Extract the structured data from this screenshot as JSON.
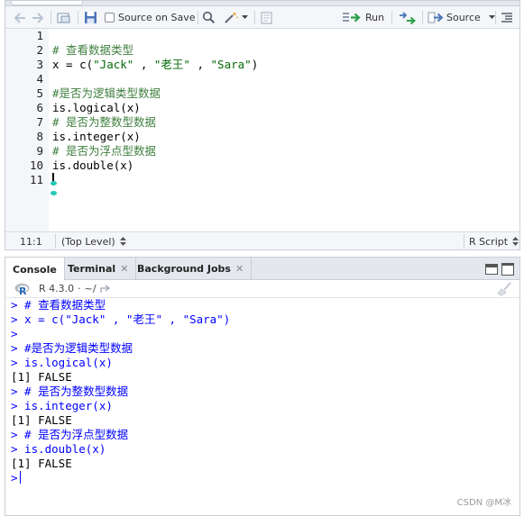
{
  "editor": {
    "toolbar": {
      "source_on_save_label": "Source on Save",
      "run_label": "Run",
      "source_label": "Source"
    },
    "line_numbers": [
      "1",
      "2",
      "3",
      "4",
      "5",
      "6",
      "7",
      "8",
      "9",
      "10",
      "11"
    ],
    "code_lines": [
      {
        "text": "",
        "kind": "plain"
      },
      {
        "text": "# 查看数据类型",
        "kind": "comment"
      },
      {
        "text": "x = c(\"Jack\" , \"老王\" , \"Sara\")",
        "kind": "code"
      },
      {
        "text": "",
        "kind": "plain"
      },
      {
        "text": "#是否为逻辑类型数据",
        "kind": "comment"
      },
      {
        "text": "is.logical(x)",
        "kind": "plain"
      },
      {
        "text": "# 是否为整数型数据",
        "kind": "comment"
      },
      {
        "text": "is.integer(x)",
        "kind": "plain"
      },
      {
        "text": "# 是否为浮点型数据",
        "kind": "comment"
      },
      {
        "text": "is.double(x)",
        "kind": "plain"
      },
      {
        "text": "",
        "kind": "cursor"
      }
    ],
    "status": {
      "position": "11:1",
      "scope": "(Top Level)",
      "file_type": "R Script"
    }
  },
  "console": {
    "tabs": [
      {
        "label": "Console",
        "closable": false
      },
      {
        "label": "Terminal",
        "closable": true
      },
      {
        "label": "Background Jobs",
        "closable": true
      }
    ],
    "r_version": "R 4.3.0",
    "separator": "·",
    "working_dir": "~/",
    "lines": [
      {
        "text": "> # 查看数据类型",
        "kind": "in"
      },
      {
        "text": "> x = c(\"Jack\" , \"老王\" , \"Sara\")",
        "kind": "in"
      },
      {
        "text": ">",
        "kind": "in"
      },
      {
        "text": "> #是否为逻辑类型数据",
        "kind": "in"
      },
      {
        "text": "> is.logical(x)",
        "kind": "in"
      },
      {
        "text": "[1] FALSE",
        "kind": "out"
      },
      {
        "text": "> # 是否为整数型数据",
        "kind": "in"
      },
      {
        "text": "> is.integer(x)",
        "kind": "in"
      },
      {
        "text": "[1] FALSE",
        "kind": "out"
      },
      {
        "text": "> # 是否为浮点型数据",
        "kind": "in"
      },
      {
        "text": "> is.double(x)",
        "kind": "in"
      },
      {
        "text": "[1] FALSE",
        "kind": "out"
      },
      {
        "text": ">",
        "kind": "prompt"
      }
    ]
  },
  "watermark": "CSDN @M冰",
  "colors": {
    "comment": "#408040",
    "console_input": "#0000ff",
    "run_arrow": "#2aa14a",
    "r_logo": "#2266b8"
  },
  "icons": [
    "back-arrow-icon",
    "forward-arrow-icon",
    "show-in-window-icon",
    "save-icon",
    "search-icon",
    "magic-wand-icon",
    "compile-report-icon",
    "run-icon",
    "rerun-icon",
    "source-icon",
    "outline-icon",
    "r-logo-icon",
    "go-to-directory-icon",
    "clear-console-icon"
  ]
}
